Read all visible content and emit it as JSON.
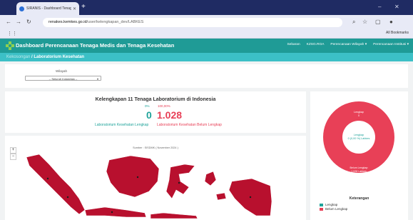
{
  "browser": {
    "tab_title": "SIRANIS - Dashboard Tenaga...",
    "url_host": "renakes.kemkes.go.id",
    "url_path": "/user/kelengkapan_dev/LABKES",
    "all_bookmarks": "All Bookmarks"
  },
  "navbar": {
    "brand": "Dashboard Perencanaan Tenaga Medis dan Tenaga Kesehatan",
    "items": [
      "Sebaran",
      "KZSG.ROA",
      "Perencanaan Wilayah",
      "Perencanaan Institusi"
    ]
  },
  "breadcrumb": {
    "parent": "Kekosongan",
    "sep": " / ",
    "current": "Laboratorium Kesehatan"
  },
  "filter": {
    "label": "Wilayah",
    "selected": "-- Seluruh Indonesia --"
  },
  "summary": {
    "title": "Kelengkapan 11 Tenaga Laboratorium di Indonesia",
    "complete_pct": "0%",
    "incomplete_pct": "100,00%",
    "complete_count": "0",
    "incomplete_count": "1.028",
    "complete_label": "Laboratorium Kesehatan Lengkap",
    "incomplete_label": "Laboratorium Kesehatan Belum Lengkap"
  },
  "map": {
    "source": "Sumber : SISDMK ( November 2024 )"
  },
  "donut": {
    "center_label": "Lengkap",
    "center_value": "0 (0,00 %) Labkes",
    "top_label": "Lengkap",
    "top_value": "0",
    "bottom_label": "Belum Lengkap",
    "bottom_value": "1.028 Labkes"
  },
  "legend": {
    "title": "Keterangan",
    "items": [
      {
        "label": "Lengkap",
        "color": "#1fa39a"
      },
      {
        "label": "Belum Lengkap",
        "color": "#e84057"
      }
    ]
  },
  "colors": {
    "teal": "#1f9b96",
    "red": "#e84057",
    "map_red": "#b8102e"
  }
}
